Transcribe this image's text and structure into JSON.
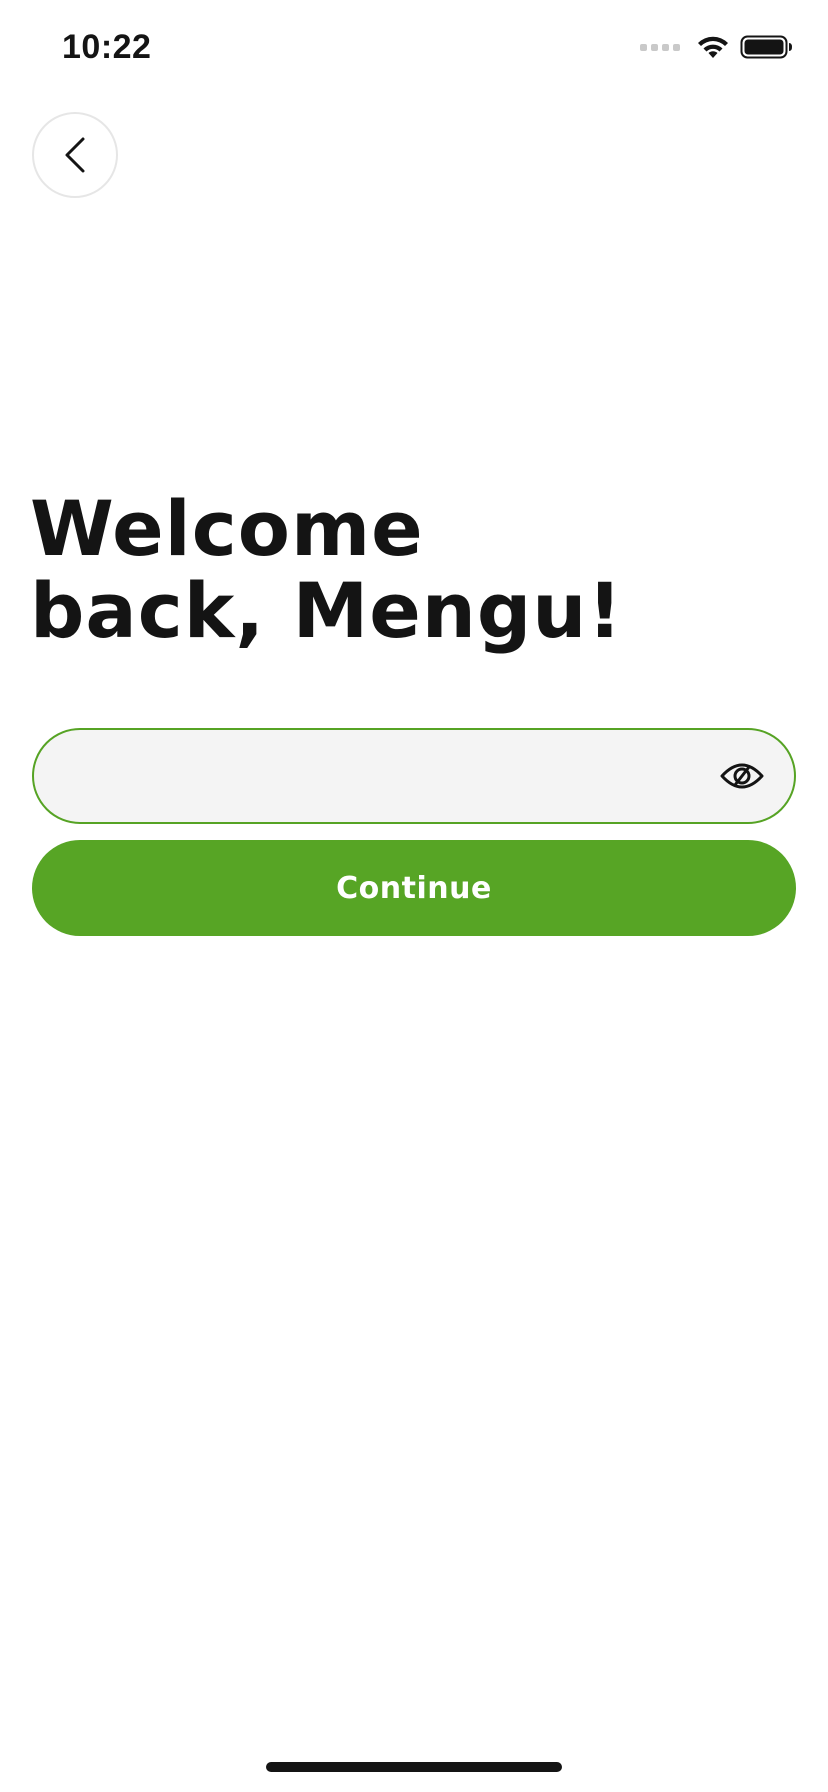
{
  "status_bar": {
    "time": "10:22",
    "signal_icon": "cellular-signal-icon",
    "wifi_icon": "wifi-icon",
    "battery_icon": "battery-icon"
  },
  "header": {
    "back_icon": "chevron-left-icon"
  },
  "title": {
    "line1": "Welcome",
    "line2": "back, Mengu!"
  },
  "password": {
    "value": "",
    "placeholder": "",
    "toggle_icon": "eye-off-icon"
  },
  "continue_button": {
    "label": "Continue"
  },
  "colors": {
    "accent": "#57a525",
    "field_border": "#56a324",
    "field_background": "#f4f4f4",
    "text": "#141414"
  }
}
